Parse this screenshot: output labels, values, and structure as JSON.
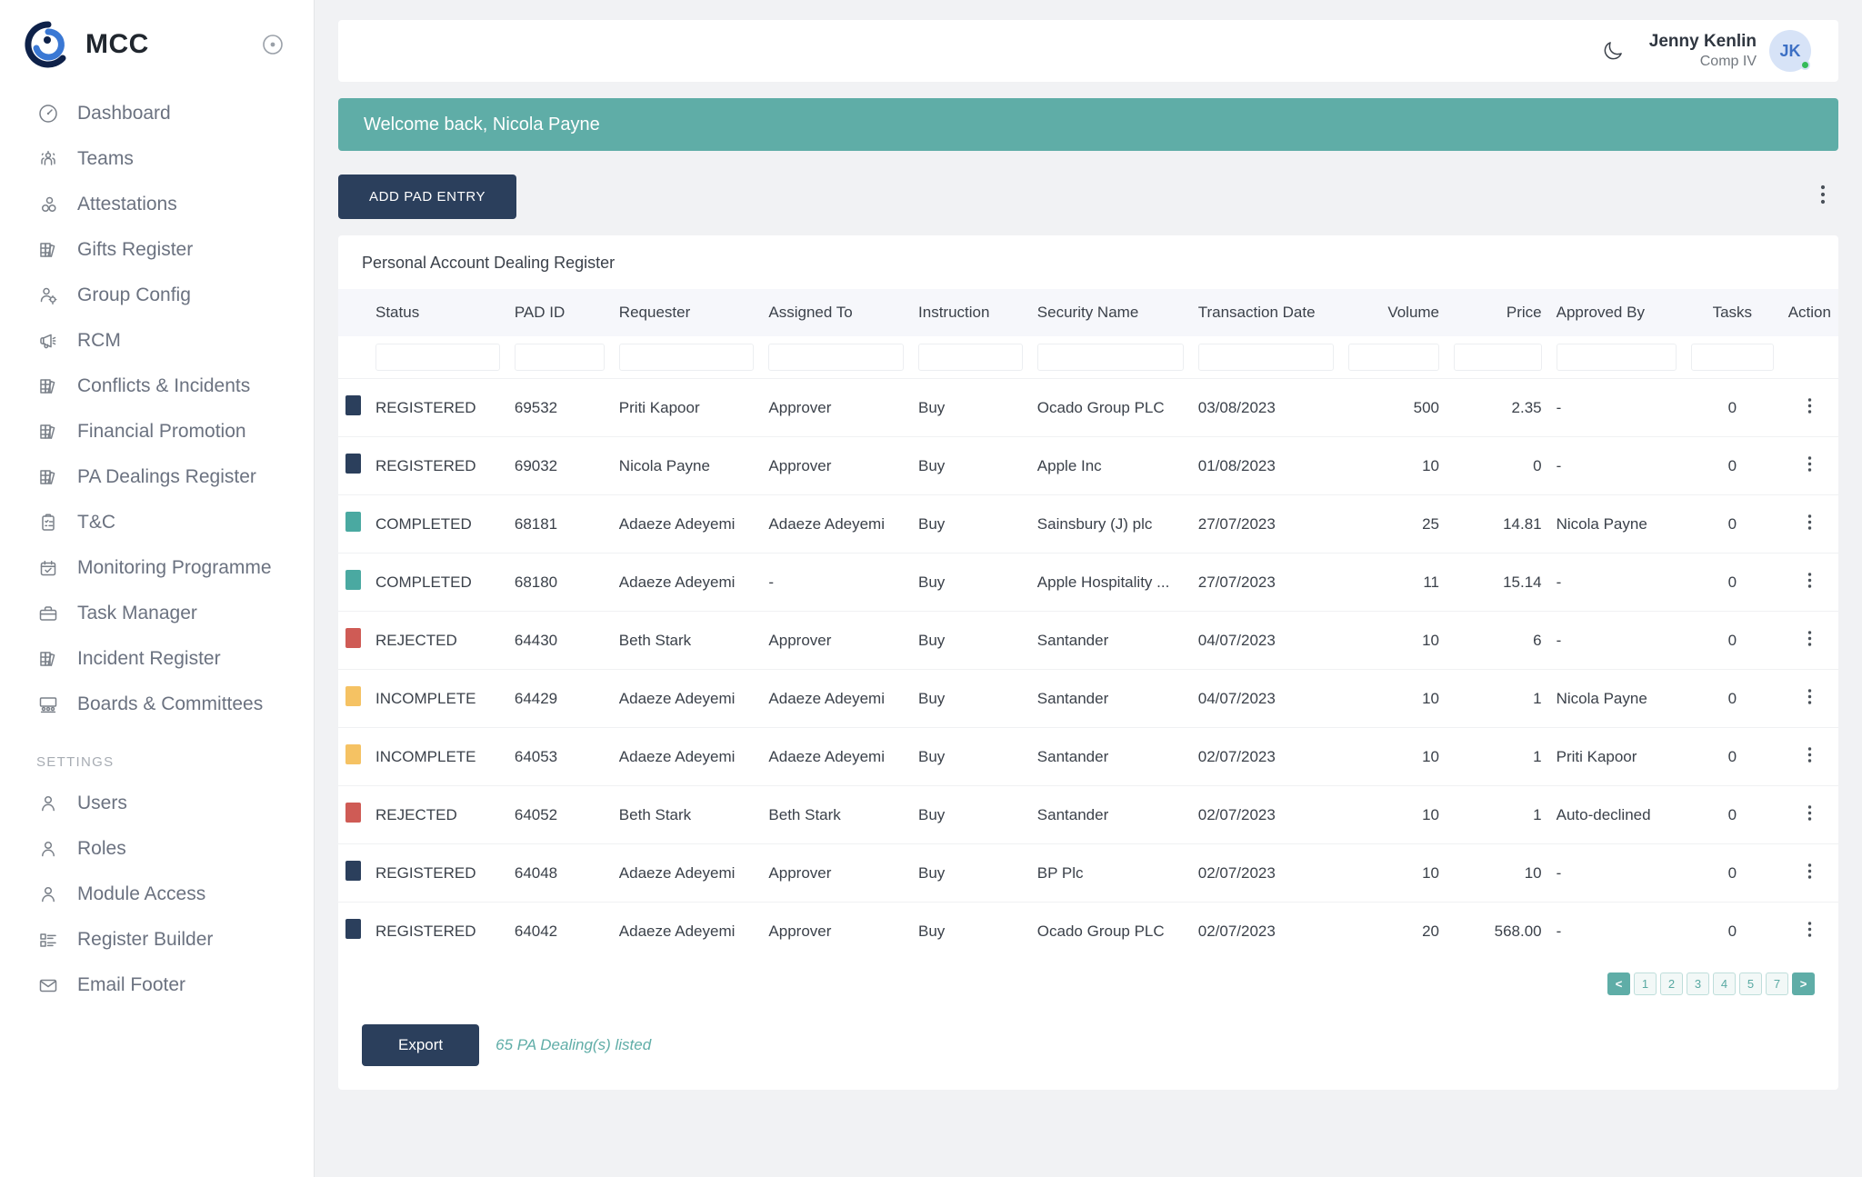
{
  "brand": {
    "name": "MCC",
    "logo_icon": "mcc-logo-icon",
    "collapse_icon": "collapse-circle-icon"
  },
  "sidebar": {
    "items": [
      {
        "label": "Dashboard",
        "icon": "dashboard-icon"
      },
      {
        "label": "Teams",
        "icon": "teams-icon"
      },
      {
        "label": "Attestations",
        "icon": "attestations-icon"
      },
      {
        "label": "Gifts Register",
        "icon": "books-icon"
      },
      {
        "label": "Group Config",
        "icon": "user-gear-icon"
      },
      {
        "label": "RCM",
        "icon": "megaphone-icon"
      },
      {
        "label": "Conflicts & Incidents",
        "icon": "books-icon"
      },
      {
        "label": "Financial Promotion",
        "icon": "books-icon"
      },
      {
        "label": "PA Dealings Register",
        "icon": "books-icon"
      },
      {
        "label": "T&C",
        "icon": "clipboard-icon"
      },
      {
        "label": "Monitoring Programme",
        "icon": "calendar-check-icon"
      },
      {
        "label": "Task Manager",
        "icon": "briefcase-icon"
      },
      {
        "label": "Incident Register",
        "icon": "books-icon"
      },
      {
        "label": "Boards & Committees",
        "icon": "boards-icon"
      }
    ],
    "settings_label": "SETTINGS",
    "settings_items": [
      {
        "label": "Users",
        "icon": "user-icon"
      },
      {
        "label": "Roles",
        "icon": "user-icon"
      },
      {
        "label": "Module Access",
        "icon": "user-icon"
      },
      {
        "label": "Register Builder",
        "icon": "list-builder-icon"
      },
      {
        "label": "Email Footer",
        "icon": "envelope-icon"
      }
    ]
  },
  "topbar": {
    "theme_toggle_icon": "moon-icon",
    "user_name": "Jenny Kenlin",
    "user_role": "Comp IV",
    "avatar_initials": "JK",
    "status": "online"
  },
  "banner": {
    "text": "Welcome back, Nicola Payne",
    "color": "#5fada7"
  },
  "toolbar": {
    "add_label": "ADD PAD ENTRY",
    "overflow_icon": "kebab-menu-icon"
  },
  "table": {
    "title": "Personal Account Dealing Register",
    "columns": [
      "",
      "Status",
      "PAD ID",
      "Requester",
      "Assigned To",
      "Instruction",
      "Security Name",
      "Transaction Date",
      "Volume",
      "Price",
      "Approved By",
      "Tasks",
      "Action"
    ],
    "filter_placeholder": "",
    "status_colors": {
      "REGISTERED": "#2b3f5c",
      "COMPLETED": "#4aa9a1",
      "REJECTED": "#cf5b55",
      "INCOMPLETE": "#f5c263"
    },
    "rows": [
      {
        "status": "REGISTERED",
        "pad_id": "69532",
        "requester": "Priti Kapoor",
        "assigned_to": "Approver",
        "instruction": "Buy",
        "security_name": "Ocado Group PLC",
        "transaction_date": "03/08/2023",
        "volume": "500",
        "price": "2.35",
        "approved_by": "-",
        "tasks": "0"
      },
      {
        "status": "REGISTERED",
        "pad_id": "69032",
        "requester": "Nicola Payne",
        "assigned_to": "Approver",
        "instruction": "Buy",
        "security_name": "Apple Inc",
        "transaction_date": "01/08/2023",
        "volume": "10",
        "price": "0",
        "approved_by": "-",
        "tasks": "0"
      },
      {
        "status": "COMPLETED",
        "pad_id": "68181",
        "requester": "Adaeze Adeyemi",
        "assigned_to": "Adaeze Adeyemi",
        "instruction": "Buy",
        "security_name": "Sainsbury (J) plc",
        "transaction_date": "27/07/2023",
        "volume": "25",
        "price": "14.81",
        "approved_by": "Nicola Payne",
        "tasks": "0"
      },
      {
        "status": "COMPLETED",
        "pad_id": "68180",
        "requester": "Adaeze Adeyemi",
        "assigned_to": "-",
        "instruction": "Buy",
        "security_name": "Apple Hospitality ...",
        "transaction_date": "27/07/2023",
        "volume": "11",
        "price": "15.14",
        "approved_by": "-",
        "tasks": "0"
      },
      {
        "status": "REJECTED",
        "pad_id": "64430",
        "requester": "Beth Stark",
        "assigned_to": "Approver",
        "instruction": "Buy",
        "security_name": "Santander",
        "transaction_date": "04/07/2023",
        "volume": "10",
        "price": "6",
        "approved_by": "-",
        "tasks": "0"
      },
      {
        "status": "INCOMPLETE",
        "pad_id": "64429",
        "requester": "Adaeze Adeyemi",
        "assigned_to": "Adaeze Adeyemi",
        "instruction": "Buy",
        "security_name": "Santander",
        "transaction_date": "04/07/2023",
        "volume": "10",
        "price": "1",
        "approved_by": "Nicola Payne",
        "tasks": "0"
      },
      {
        "status": "INCOMPLETE",
        "pad_id": "64053",
        "requester": "Adaeze Adeyemi",
        "assigned_to": "Adaeze Adeyemi",
        "instruction": "Buy",
        "security_name": "Santander",
        "transaction_date": "02/07/2023",
        "volume": "10",
        "price": "1",
        "approved_by": "Priti Kapoor",
        "tasks": "0"
      },
      {
        "status": "REJECTED",
        "pad_id": "64052",
        "requester": "Beth Stark",
        "assigned_to": "Beth Stark",
        "instruction": "Buy",
        "security_name": "Santander",
        "transaction_date": "02/07/2023",
        "volume": "10",
        "price": "1",
        "approved_by": "Auto-declined",
        "tasks": "0"
      },
      {
        "status": "REGISTERED",
        "pad_id": "64048",
        "requester": "Adaeze Adeyemi",
        "assigned_to": "Approver",
        "instruction": "Buy",
        "security_name": "BP Plc",
        "transaction_date": "02/07/2023",
        "volume": "10",
        "price": "10",
        "approved_by": "-",
        "tasks": "0"
      },
      {
        "status": "REGISTERED",
        "pad_id": "64042",
        "requester": "Adaeze Adeyemi",
        "assigned_to": "Approver",
        "instruction": "Buy",
        "security_name": "Ocado Group PLC",
        "transaction_date": "02/07/2023",
        "volume": "20",
        "price": "568.00",
        "approved_by": "-",
        "tasks": "0"
      }
    ]
  },
  "pagination": {
    "pages": [
      "<",
      "1",
      "2",
      "3",
      "4",
      "5",
      "7",
      ">"
    ]
  },
  "footer": {
    "export_label": "Export",
    "listed_text": "65 PA Dealing(s) listed"
  }
}
